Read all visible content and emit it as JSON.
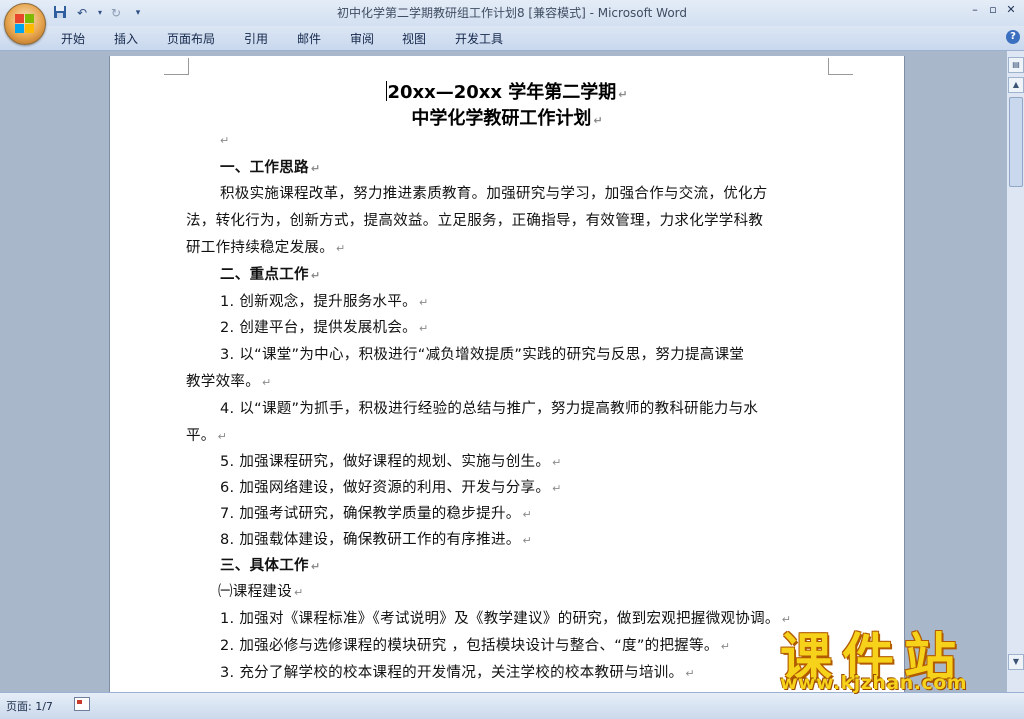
{
  "window": {
    "title": "初中化学第二学期教研组工作计划8 [兼容模式] - Microsoft Word"
  },
  "quick_access": {
    "icons": [
      "save-icon",
      "undo-icon",
      "redo-icon",
      "customize-icon"
    ]
  },
  "ribbon": {
    "tabs": [
      "开始",
      "插入",
      "页面布局",
      "引用",
      "邮件",
      "审阅",
      "视图",
      "开发工具"
    ]
  },
  "document": {
    "title_line1": "20xx—20xx 学年第二学期",
    "title_line2": "中学化学教研工作计划",
    "lines": [
      "一、工作思路",
      "积极实施课程改革，努力推进素质教育。加强研究与学习，加强合作与交流，优化方",
      "法，转化行为，创新方式，提高效益。立足服务，正确指导，有效管理，力求化学学科教",
      "研工作持续稳定发展。",
      "二、重点工作",
      "1. 创新观念，提升服务水平。",
      "2. 创建平台，提供发展机会。",
      "3. 以“课堂”为中心，积极进行“减负增效提质”实践的研究与反思，努力提高课堂",
      "教学效率。",
      "4. 以“课题”为抓手，积极进行经验的总结与推广，努力提高教师的教科研能力与水",
      "平。",
      "5. 加强课程研究，做好课程的规划、实施与创生。",
      "6. 加强网络建设，做好资源的利用、开发与分享。",
      "7. 加强考试研究，确保教学质量的稳步提升。",
      "8. 加强载体建设，确保教研工作的有序推进。",
      "三、具体工作",
      "㈠课程建设",
      "1. 加强对《课程标准》《考试说明》及《教学建议》的研究，做到宏观把握微观协调。",
      "2. 加强必修与选修课程的模块研究  ，包括模块设计与整合、“度”的把握等。",
      "3. 充分了解学校的校本课程的开发情况，关注学校的校本教研与培训。"
    ]
  },
  "status": {
    "page": "页面: 1/7"
  },
  "watermark": {
    "brand": "课件站",
    "url": "www.kjzhan.com"
  }
}
